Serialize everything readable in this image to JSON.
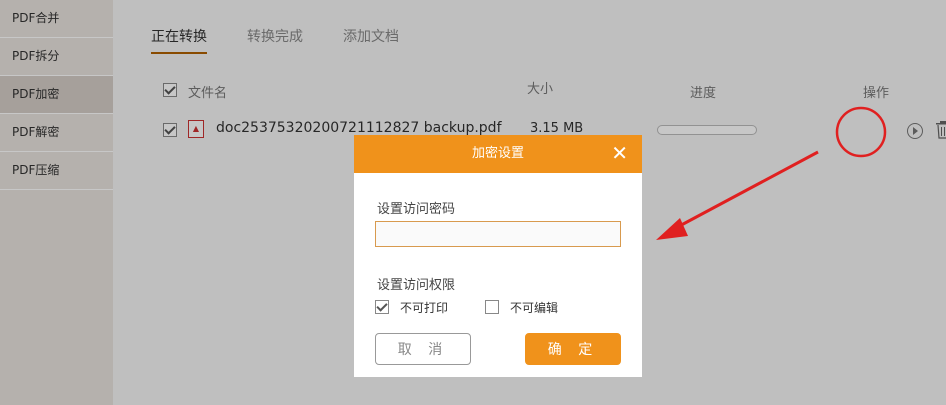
{
  "sidebar": {
    "items": [
      {
        "label": "PDF合并"
      },
      {
        "label": "PDF拆分"
      },
      {
        "label": "PDF加密"
      },
      {
        "label": "PDF解密"
      },
      {
        "label": "PDF压缩"
      }
    ],
    "active_index": 2
  },
  "tabs": [
    {
      "label": "正在转换"
    },
    {
      "label": "转换完成"
    },
    {
      "label": "添加文档"
    }
  ],
  "table": {
    "headers": {
      "filename": "文件名",
      "size": "大小",
      "progress": "进度",
      "action": "操作"
    },
    "rows": [
      {
        "filename": "doc2537532020072111282​7 backup.pdf",
        "size": "3.15 MB",
        "progress": 0,
        "checked": true
      }
    ]
  },
  "dialog": {
    "title": "加密设置",
    "password_label": "设置访问密码",
    "password_value": "",
    "permission_label": "设置访问权限",
    "no_print_label": "不可打印",
    "no_print_checked": true,
    "no_edit_label": "不可编辑",
    "no_edit_checked": false,
    "cancel_label": "取 消",
    "ok_label": "确 定"
  },
  "colors": {
    "accent": "#f0921b",
    "annotation": "#e02020"
  }
}
